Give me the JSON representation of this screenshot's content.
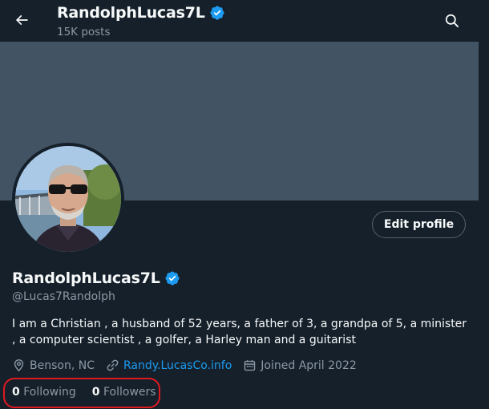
{
  "header": {
    "name": "RandolphLucas7L",
    "posts": "15K posts",
    "back_icon": "arrow-left-icon",
    "search_icon": "search-icon"
  },
  "profile": {
    "display_name": "RandolphLucas7L",
    "verified": true,
    "handle": "@Lucas7Randolph",
    "bio": "I am a Christian , a husband of 52 years, a father of 3, a grandpa of 5, a minister , a computer scientist , a golfer, a Harley man and a guitarist",
    "edit_button": "Edit profile",
    "location": "Benson, NC",
    "website": "Randy.LucasCo.info",
    "joined": "Joined April 2022"
  },
  "stats": {
    "following_count": "0",
    "following_label": "Following",
    "followers_count": "0",
    "followers_label": "Followers"
  },
  "colors": {
    "background": "#15202b",
    "banner": "#425364",
    "accent": "#1d9bf0",
    "secondary_text": "#8b98a5",
    "highlight": "#e0191f"
  }
}
